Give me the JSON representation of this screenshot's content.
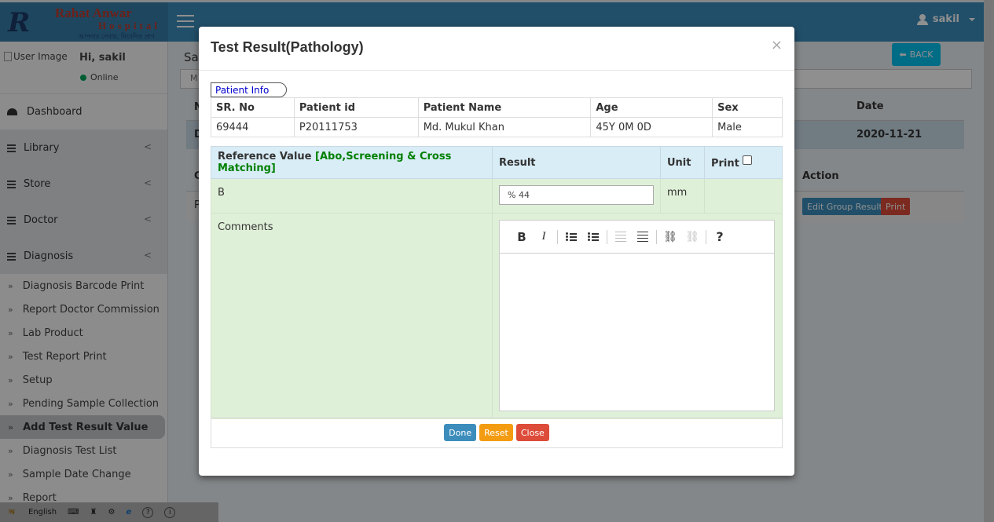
{
  "header": {
    "logo_mark": "R",
    "logo_title": "Rahat Anwar",
    "logo_sub": "Hospital",
    "logo_tag": "আপনার সেবায়, নিবেদিত প্রাণ",
    "username": "sakil"
  },
  "sidebar": {
    "user_image_alt": "User Image",
    "greeting": "Hi, sakil",
    "status": "Online",
    "nav": [
      {
        "label": "Dashboard"
      },
      {
        "label": "Library"
      },
      {
        "label": "Store"
      },
      {
        "label": "Doctor"
      },
      {
        "label": "Diagnosis"
      }
    ],
    "sub_items": [
      {
        "label": "Diagnosis Barcode Print"
      },
      {
        "label": "Report Doctor Commission"
      },
      {
        "label": "Lab Product"
      },
      {
        "label": "Test Report Print"
      },
      {
        "label": "Setup"
      },
      {
        "label": "Pending Sample Collection"
      },
      {
        "label": "Add Test Result Value"
      },
      {
        "label": "Diagnosis Test List"
      },
      {
        "label": "Sample Date Change"
      },
      {
        "label": "Report"
      }
    ]
  },
  "background": {
    "page_title": "Sar",
    "back_label": "BACK",
    "search_prefix": "M",
    "col_first": "N",
    "col_date": "Date",
    "row_first": "D",
    "row_date": "2020-11-21",
    "section_g": "G",
    "action_header": "Action",
    "row3_first": "P",
    "edit_group_label": "Edit Group Result",
    "print_label": "Print"
  },
  "taskbar": {
    "language": "English"
  },
  "modal": {
    "title": "Test Result(Pathology)",
    "close_glyph": "×",
    "patient_info_legend": "Patient Info",
    "patient_headers": [
      "SR. No",
      "Patient id",
      "Patient Name",
      "Age",
      "Sex"
    ],
    "patient_row": [
      "69444",
      "P20111753",
      "Md. Mukul Khan",
      "45Y 0M 0D",
      "Male"
    ],
    "result_headers": {
      "reference_prefix": "Reference Value",
      "reference_group": "[Abo,Screening & Cross Matching]",
      "result": "Result",
      "unit": "Unit",
      "print": "Print"
    },
    "result_row": {
      "reference": "B",
      "value": "% 44",
      "unit": "mm"
    },
    "comments_label": "Comments",
    "buttons": {
      "done": "Done",
      "reset": "Reset",
      "close": "Close"
    }
  }
}
